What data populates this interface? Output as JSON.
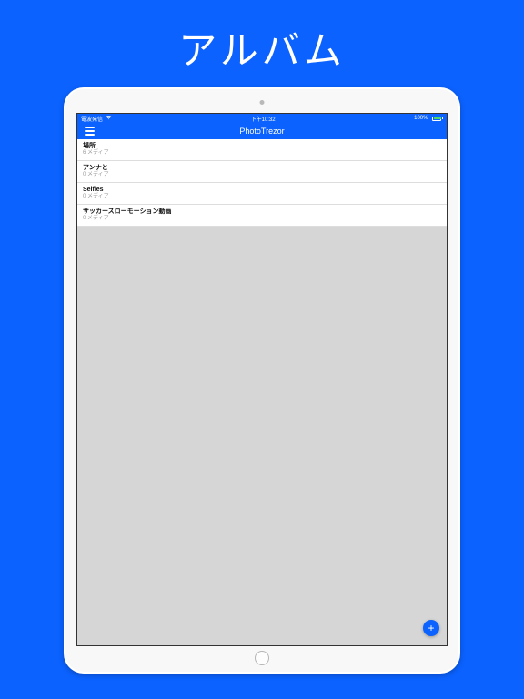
{
  "heading": "アルバム",
  "status": {
    "carrier": "電波発信",
    "time": "下午10:32",
    "battery_pct": "100%"
  },
  "nav": {
    "title": "PhotoTrezor"
  },
  "albums": [
    {
      "title": "場所",
      "subtitle": "6 メディア"
    },
    {
      "title": "アンナと",
      "subtitle": "0 メディア"
    },
    {
      "title": "Selfies",
      "subtitle": "0 メディア"
    },
    {
      "title": "サッカースローモーション動画",
      "subtitle": "0 メディア"
    }
  ],
  "fab": {
    "label": "+"
  }
}
